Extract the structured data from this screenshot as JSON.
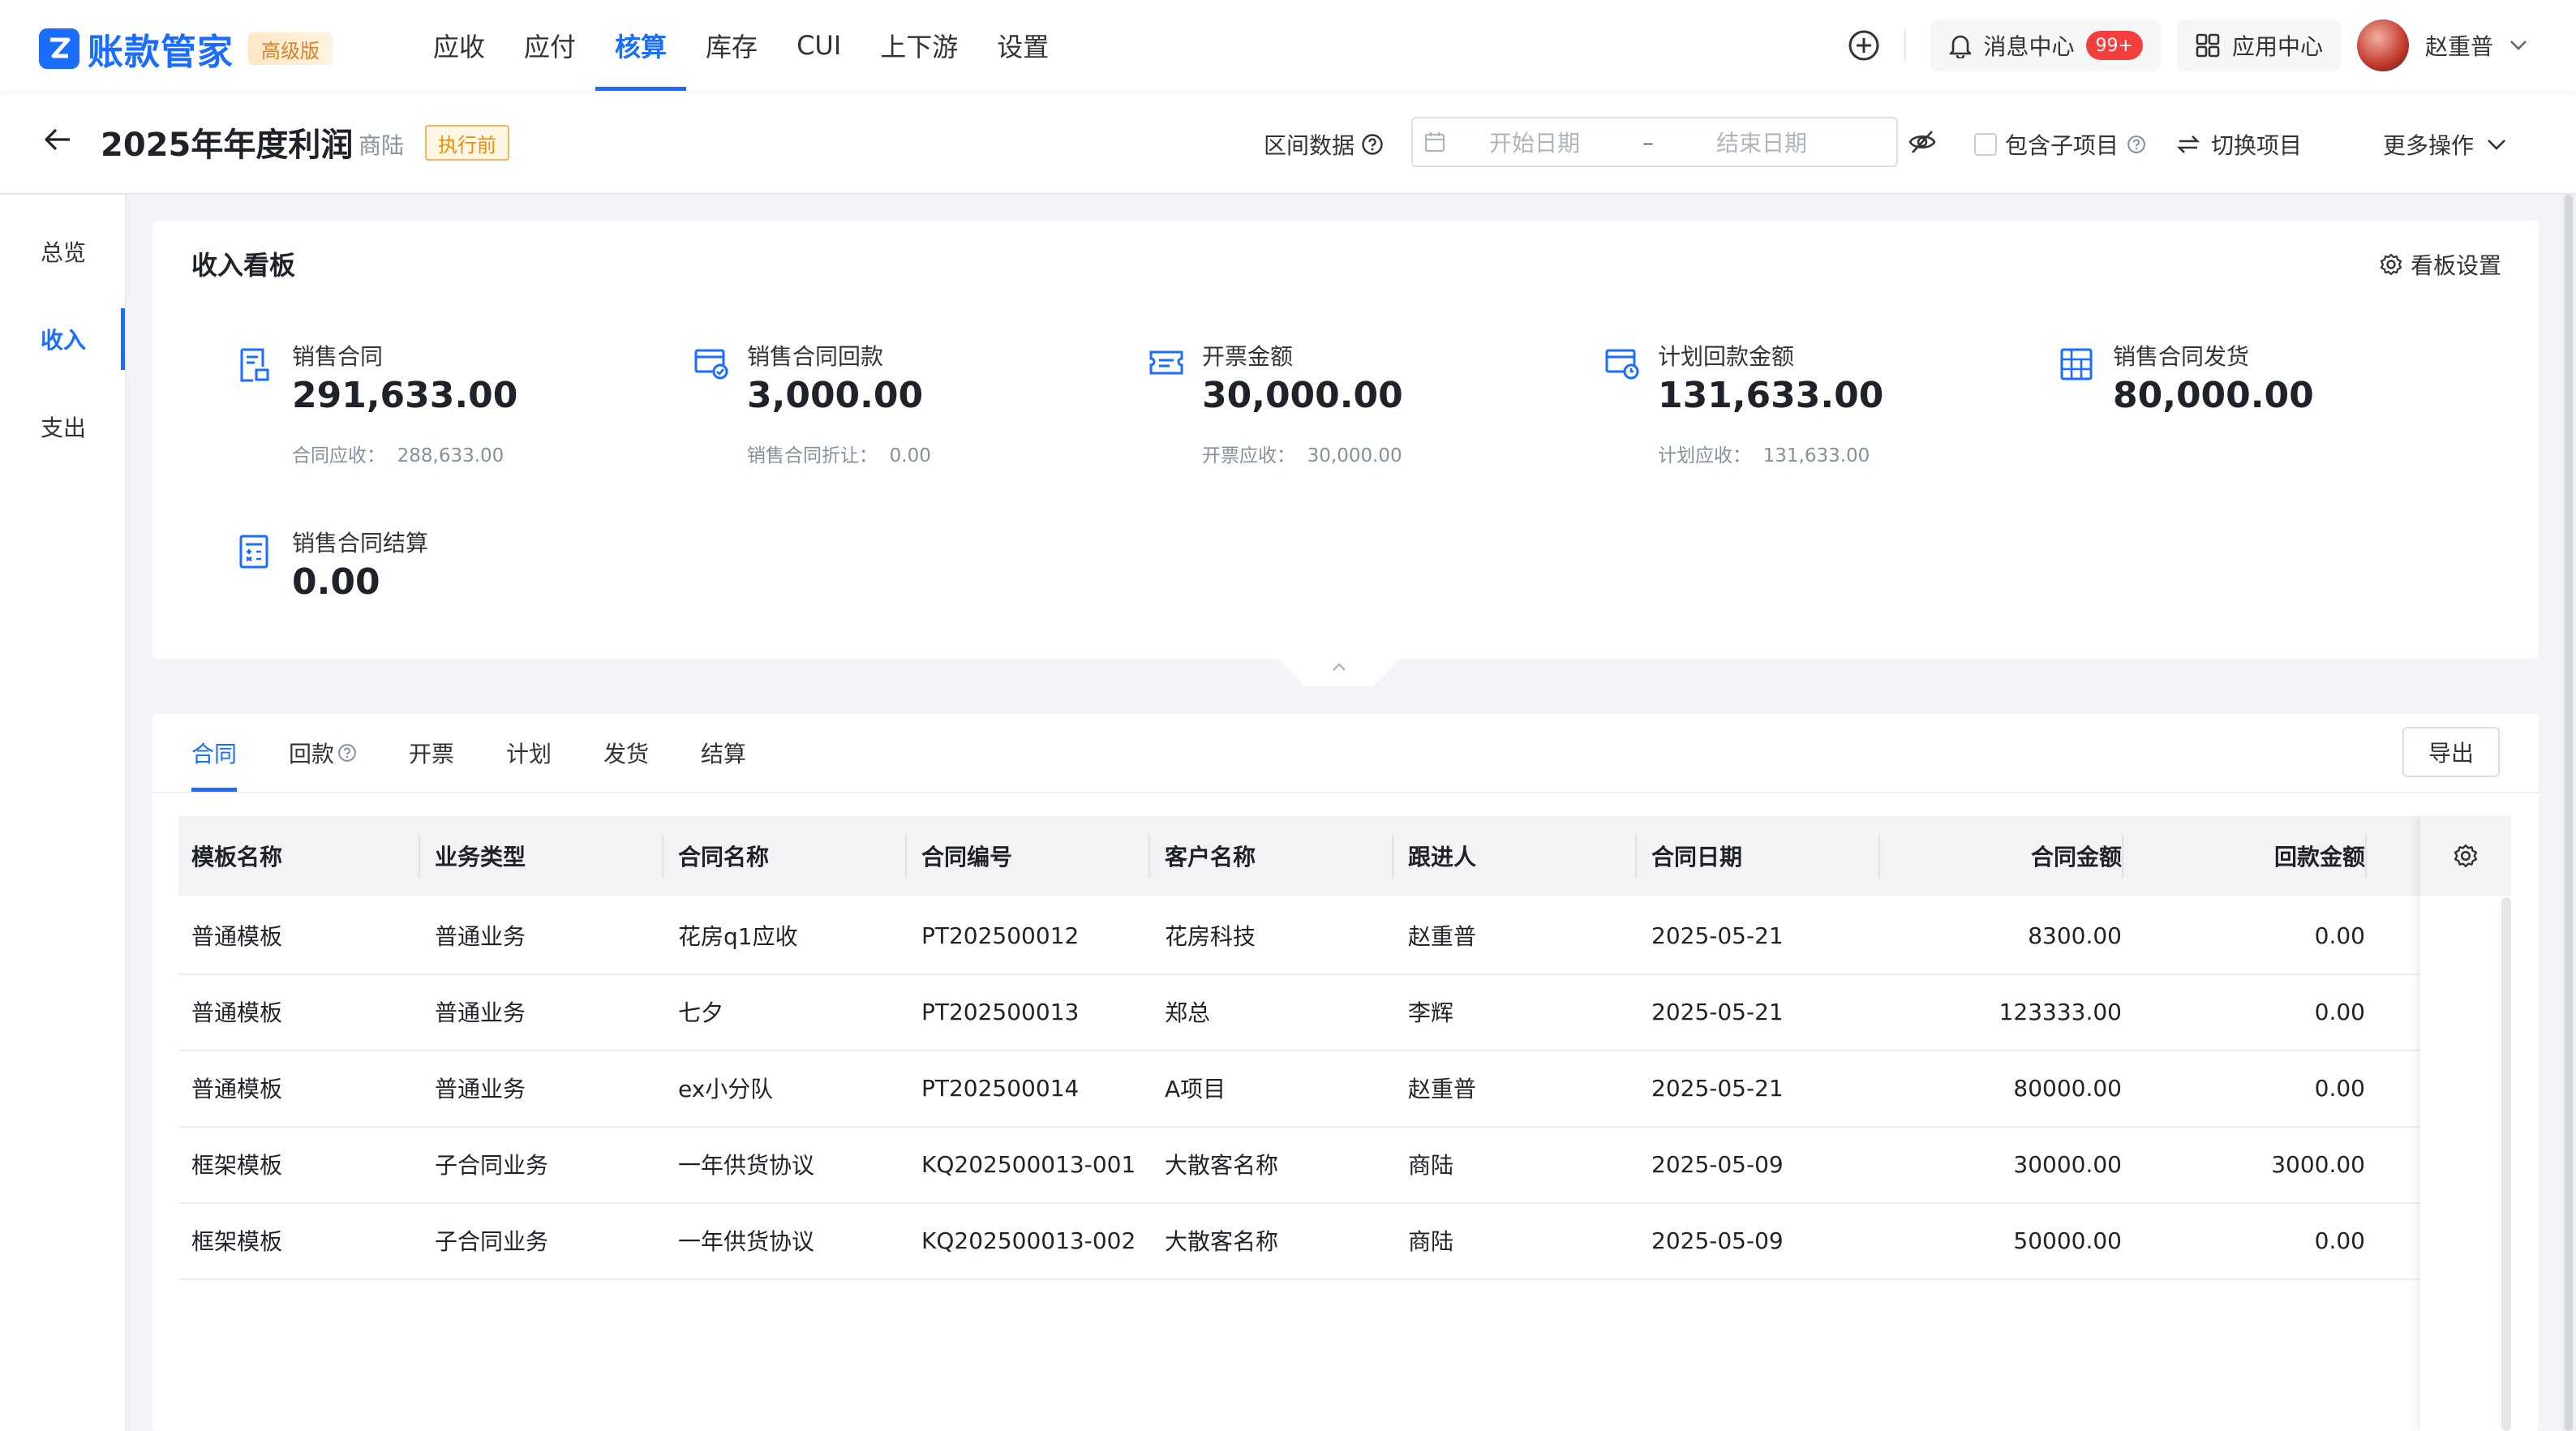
{
  "app": {
    "logo_text": "账款管家",
    "edition_badge": "高级版",
    "nav": [
      "应收",
      "应付",
      "核算",
      "库存",
      "CUI",
      "上下游",
      "设置"
    ],
    "nav_active": "核算",
    "message_center": "消息中心",
    "message_count": "99+",
    "app_center": "应用中心",
    "user_name": "赵重普"
  },
  "project": {
    "title": "2025年年度利润",
    "owner": "商陆",
    "status": "执行前",
    "range_label": "区间数据",
    "start_placeholder": "开始日期",
    "range_dash": "–",
    "end_placeholder": "结束日期",
    "include_sub_label": "包含子项目",
    "switch_label": "切换项目",
    "more_label": "更多操作"
  },
  "sidebar": {
    "items": [
      "总览",
      "收入",
      "支出"
    ],
    "active": "收入"
  },
  "dashboard": {
    "title": "收入看板",
    "settings_label": "看板设置",
    "metrics": [
      {
        "label": "销售合同",
        "value": "291,633.00",
        "sub_label": "合同应收：",
        "sub_value": "288,633.00",
        "icon": "contract-doc-icon"
      },
      {
        "label": "销售合同回款",
        "value": "3,000.00",
        "sub_label": "销售合同折让：",
        "sub_value": "0.00",
        "icon": "payment-card-icon"
      },
      {
        "label": "开票金额",
        "value": "30,000.00",
        "sub_label": "开票应收：",
        "sub_value": "30,000.00",
        "icon": "invoice-ticket-icon"
      },
      {
        "label": "计划回款金额",
        "value": "131,633.00",
        "sub_label": "计划应收：",
        "sub_value": "131,633.00",
        "icon": "plan-card-icon"
      },
      {
        "label": "销售合同发货",
        "value": "80,000.00",
        "sub_label": "",
        "sub_value": "",
        "icon": "shipment-grid-icon"
      },
      {
        "label": "销售合同结算",
        "value": "0.00",
        "sub_label": "",
        "sub_value": "",
        "icon": "calculator-icon"
      }
    ]
  },
  "table": {
    "tabs": [
      "合同",
      "回款",
      "开票",
      "计划",
      "发货",
      "结算"
    ],
    "active_tab": "合同",
    "export_label": "导出",
    "columns": [
      "模板名称",
      "业务类型",
      "合同名称",
      "合同编号",
      "客户名称",
      "跟进人",
      "合同日期",
      "合同金额",
      "回款金额"
    ],
    "rows": [
      [
        "普通模板",
        "普通业务",
        "花房q1应收",
        "PT202500012",
        "花房科技",
        "赵重普",
        "2025-05-21",
        "8300.00",
        "0.00"
      ],
      [
        "普通模板",
        "普通业务",
        "七夕",
        "PT202500013",
        "郑总",
        "李辉",
        "2025-05-21",
        "123333.00",
        "0.00"
      ],
      [
        "普通模板",
        "普通业务",
        "ex小分队",
        "PT202500014",
        "A项目",
        "赵重普",
        "2025-05-21",
        "80000.00",
        "0.00"
      ],
      [
        "框架模板",
        "子合同业务",
        "一年供货协议",
        "KQ202500013-001",
        "大散客名称",
        "商陆",
        "2025-05-09",
        "30000.00",
        "3000.00"
      ],
      [
        "框架模板",
        "子合同业务",
        "一年供货协议",
        "KQ202500013-002",
        "大散客名称",
        "商陆",
        "2025-05-09",
        "50000.00",
        "0.00"
      ]
    ]
  },
  "colors": {
    "primary": "#1a6dff",
    "badge_red": "#f53f3f",
    "status_orange": "#f08c00",
    "muted_text": "#86909c"
  }
}
